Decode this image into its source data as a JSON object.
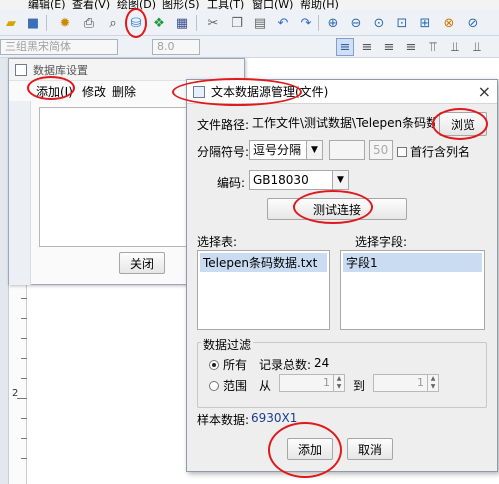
{
  "menubar": [
    "编辑(E)",
    "查看(V)",
    "绘图(D)",
    "图形(S)",
    "工具(T)",
    "窗口(W)",
    "帮助(H)"
  ],
  "toolbar2": {
    "font_value": "三组黑宋简体",
    "size_value": "8.0"
  },
  "ruler_marks": [
    "1",
    "2"
  ],
  "db_window": {
    "title": "数据库设置",
    "menu": {
      "add": "添加(I)",
      "edit": "修改",
      "delete": "删除"
    },
    "close_button": "关闭"
  },
  "text_dialog": {
    "title": "文本数据源管理(文件)",
    "file_path_label": "文件路径:",
    "file_path_value": "工作文件\\测试数据\\Telepen条码数据.txt",
    "browse_button": "浏览",
    "separator_label": "分隔符号:",
    "separator_value": "逗号分隔",
    "separator_num": "50",
    "first_row_header": "首行含列名",
    "encoding_label": "编码:",
    "encoding_value": "GB18030",
    "test_button": "测试连接",
    "select_table_label": "选择表:",
    "select_field_label": "选择字段:",
    "tables": [
      "Telepen条码数据.txt"
    ],
    "fields": [
      "字段1"
    ],
    "filter_group": "数据过滤",
    "filter_all": "所有",
    "record_total_label": "记录总数:",
    "record_total": "24",
    "filter_range": "范围",
    "from_label": "从",
    "to_label": "到",
    "from_value": "1",
    "to_value": "1",
    "sample_label": "样本数据:",
    "sample_value": "6930X1",
    "add_button": "添加",
    "cancel_button": "取消"
  },
  "colors": {
    "accent_ring": "#e0191b",
    "selection": "#c9dcf2",
    "sample_text": "#1a3d8f"
  }
}
